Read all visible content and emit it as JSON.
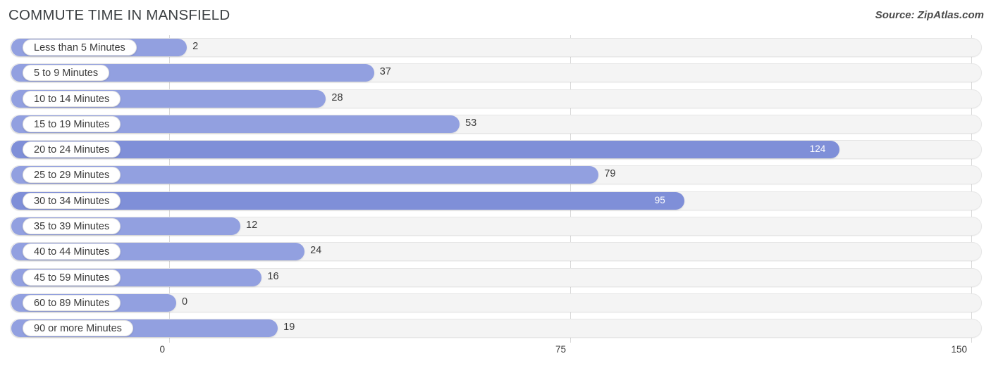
{
  "header": {
    "title": "COMMUTE TIME IN MANSFIELD",
    "source": "Source: ZipAtlas.com"
  },
  "colors": {
    "bar": "#92a0e0",
    "bar_highlight": "#7f8fd8",
    "track": "#f4f4f4",
    "gridline": "#d9d9d9",
    "text": "#3a3a3a",
    "title": "#3c4043"
  },
  "chart_data": {
    "type": "bar",
    "orientation": "horizontal",
    "title": "COMMUTE TIME IN MANSFIELD",
    "xlabel": "",
    "ylabel": "",
    "xlim": [
      0,
      150
    ],
    "xticks": [
      0,
      75,
      150
    ],
    "xtick_labels": [
      "0",
      "75",
      "150"
    ],
    "grid": true,
    "legend": false,
    "categories": [
      "Less than 5 Minutes",
      "5 to 9 Minutes",
      "10 to 14 Minutes",
      "15 to 19 Minutes",
      "20 to 24 Minutes",
      "25 to 29 Minutes",
      "30 to 34 Minutes",
      "35 to 39 Minutes",
      "40 to 44 Minutes",
      "45 to 59 Minutes",
      "60 to 89 Minutes",
      "90 or more Minutes"
    ],
    "values": [
      2,
      37,
      28,
      53,
      124,
      79,
      95,
      12,
      24,
      16,
      0,
      19
    ],
    "value_labels": [
      "2",
      "37",
      "28",
      "53",
      "124",
      "79",
      "95",
      "12",
      "24",
      "16",
      "0",
      "19"
    ]
  },
  "rows": [
    {
      "label": "Less than 5 Minutes",
      "value": 2,
      "value_label": "2",
      "inside": false,
      "highlight": false
    },
    {
      "label": "5 to 9 Minutes",
      "value": 37,
      "value_label": "37",
      "inside": false,
      "highlight": false
    },
    {
      "label": "10 to 14 Minutes",
      "value": 28,
      "value_label": "28",
      "inside": false,
      "highlight": false
    },
    {
      "label": "15 to 19 Minutes",
      "value": 53,
      "value_label": "53",
      "inside": false,
      "highlight": false
    },
    {
      "label": "20 to 24 Minutes",
      "value": 124,
      "value_label": "124",
      "inside": true,
      "highlight": true
    },
    {
      "label": "25 to 29 Minutes",
      "value": 79,
      "value_label": "79",
      "inside": false,
      "highlight": false
    },
    {
      "label": "30 to 34 Minutes",
      "value": 95,
      "value_label": "95",
      "inside": true,
      "highlight": true
    },
    {
      "label": "35 to 39 Minutes",
      "value": 12,
      "value_label": "12",
      "inside": false,
      "highlight": false
    },
    {
      "label": "40 to 44 Minutes",
      "value": 24,
      "value_label": "24",
      "inside": false,
      "highlight": false
    },
    {
      "label": "45 to 59 Minutes",
      "value": 16,
      "value_label": "16",
      "inside": false,
      "highlight": false
    },
    {
      "label": "60 to 89 Minutes",
      "value": 0,
      "value_label": "0",
      "inside": false,
      "highlight": false
    },
    {
      "label": "90 or more Minutes",
      "value": 19,
      "value_label": "19",
      "inside": false,
      "highlight": false
    }
  ],
  "axis": {
    "ticks": [
      {
        "label": "0",
        "value": 0
      },
      {
        "label": "75",
        "value": 75
      },
      {
        "label": "150",
        "value": 150
      }
    ]
  }
}
